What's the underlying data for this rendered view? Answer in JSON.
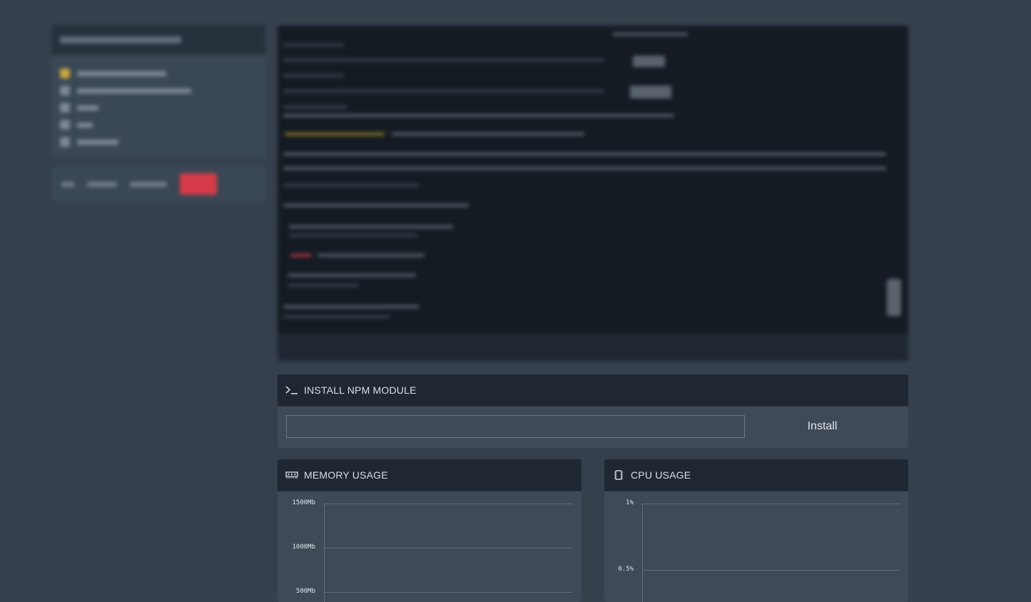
{
  "npm_panel": {
    "title": "INSTALL NPM MODULE",
    "input_value": "",
    "install_label": "Install",
    "icon": "terminal-icon"
  },
  "memory_panel": {
    "title": "MEMORY USAGE",
    "icon": "memory-icon"
  },
  "cpu_panel": {
    "title": "CPU USAGE",
    "icon": "cpu-icon"
  },
  "chart_data": [
    {
      "type": "line",
      "title": "MEMORY USAGE",
      "yticks": [
        "1500Mb",
        "1000Mb",
        "500Mb"
      ],
      "ylim": [
        0,
        1500
      ],
      "series": [],
      "grid": true
    },
    {
      "type": "line",
      "title": "CPU USAGE",
      "yticks": [
        "1%",
        "0.5%"
      ],
      "ylim": [
        0,
        1
      ],
      "series": [],
      "grid": true
    }
  ],
  "colors": {
    "background": "#36414d",
    "panel_header": "#1f2832",
    "panel_body": "#3e4a57",
    "terminal": "#141b23",
    "danger": "#d63a48"
  }
}
